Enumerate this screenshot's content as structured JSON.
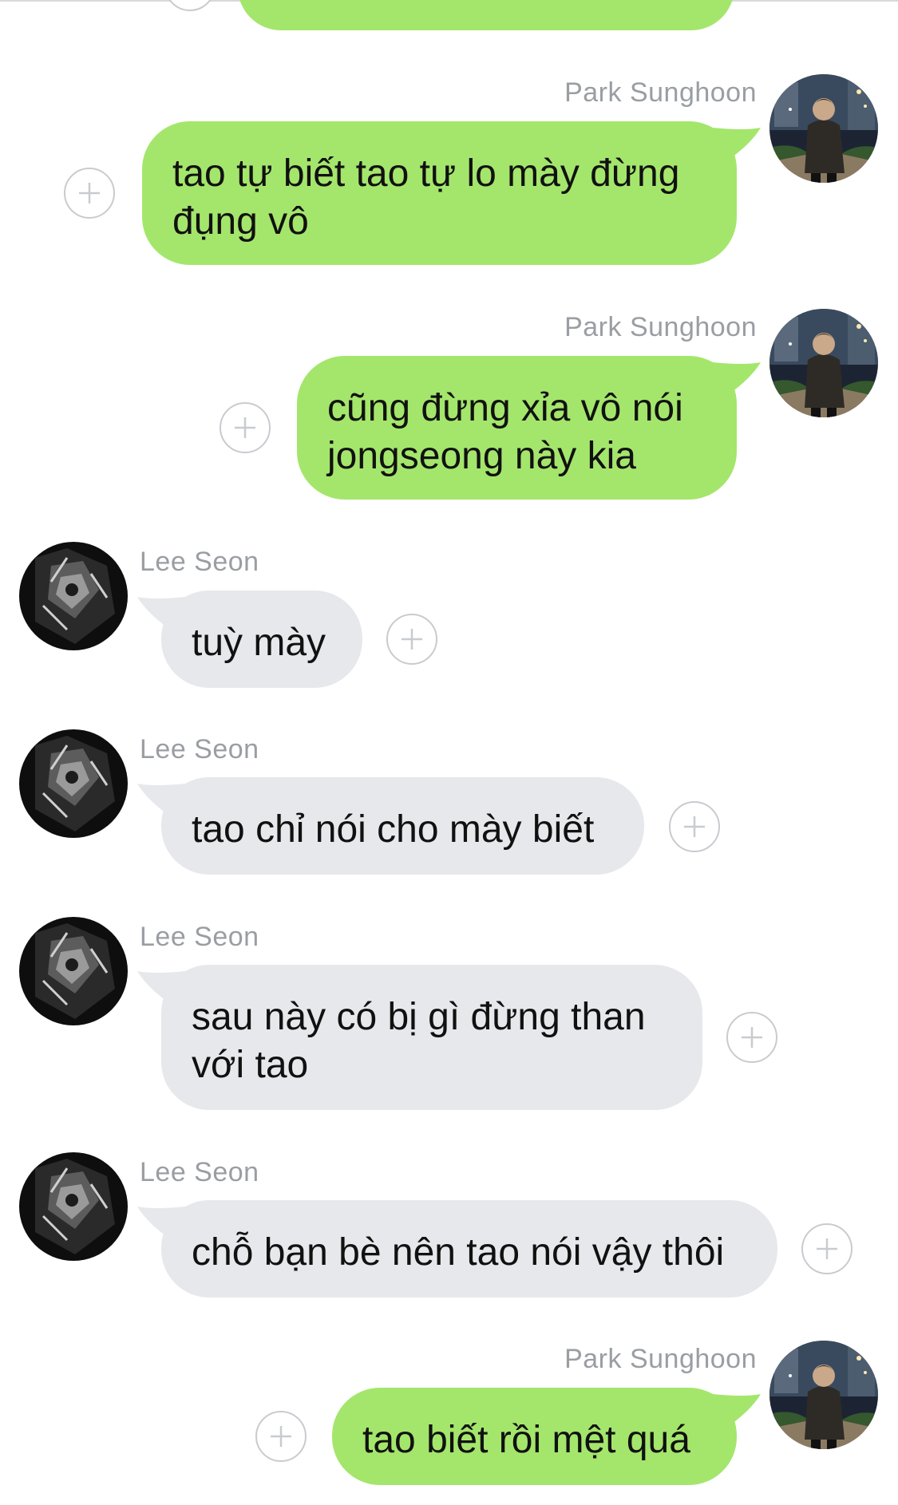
{
  "colors": {
    "sent_bubble": "#a4e66c",
    "received_bubble": "#e6e8eb",
    "name_text": "#9a9ea3",
    "plus_circle": "#c8cbcf"
  },
  "messages": [
    {
      "sender": "Park Sunghoon",
      "direction": "sent",
      "text": "tao tự biết tao tự lo mày đừng đụng vô"
    },
    {
      "sender": "Park Sunghoon",
      "direction": "sent",
      "text": "cũng đừng xỉa vô nói jongseong này kia"
    },
    {
      "sender": "Lee Seon",
      "direction": "received",
      "text": "tuỳ mày"
    },
    {
      "sender": "Lee Seon",
      "direction": "received",
      "text": "tao chỉ nói cho mày biết"
    },
    {
      "sender": "Lee Seon",
      "direction": "received",
      "text": "sau này có bị gì đừng than với tao"
    },
    {
      "sender": "Lee Seon",
      "direction": "received",
      "text": "chỗ bạn bè nên tao nói vậy thôi"
    },
    {
      "sender": "Park Sunghoon",
      "direction": "sent",
      "text": "tao biết rồi mệt quá"
    }
  ],
  "icons": {
    "add_reaction": "plus-circle-icon",
    "avatar_park": "avatar-park-sunghoon",
    "avatar_lee": "avatar-lee-seon"
  }
}
